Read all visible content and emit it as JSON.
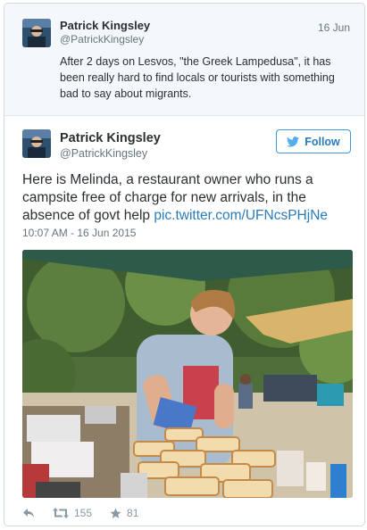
{
  "parent_tweet": {
    "author_name": "Patrick Kingsley",
    "author_handle": "@PatrickKingsley",
    "date": "16 Jun",
    "text": "After 2 days on Lesvos, \"the Greek Lampedusa\", it has been really hard to find locals or tourists with something bad to say about migrants."
  },
  "main_tweet": {
    "author_name": "Patrick Kingsley",
    "author_handle": "@PatrickKingsley",
    "follow_label": "Follow",
    "text": "Here is Melinda, a restaurant owner who runs a campsite free of charge for new arrivals, in the absence of govt help ",
    "link_text": "pic.twitter.com/UFNcsPHjNe",
    "timestamp": "10:07 AM - 16 Jun 2015",
    "retweet_count": "155",
    "favorite_count": "81"
  },
  "icons": {
    "reply": "reply-icon",
    "retweet": "retweet-icon",
    "favorite": "star-icon",
    "follow": "twitter-bird-icon"
  },
  "colors": {
    "link": "#2b7bb9",
    "follow_border": "#3a9ae0",
    "muted": "#66757f",
    "parent_bg": "#f5f8fa"
  }
}
